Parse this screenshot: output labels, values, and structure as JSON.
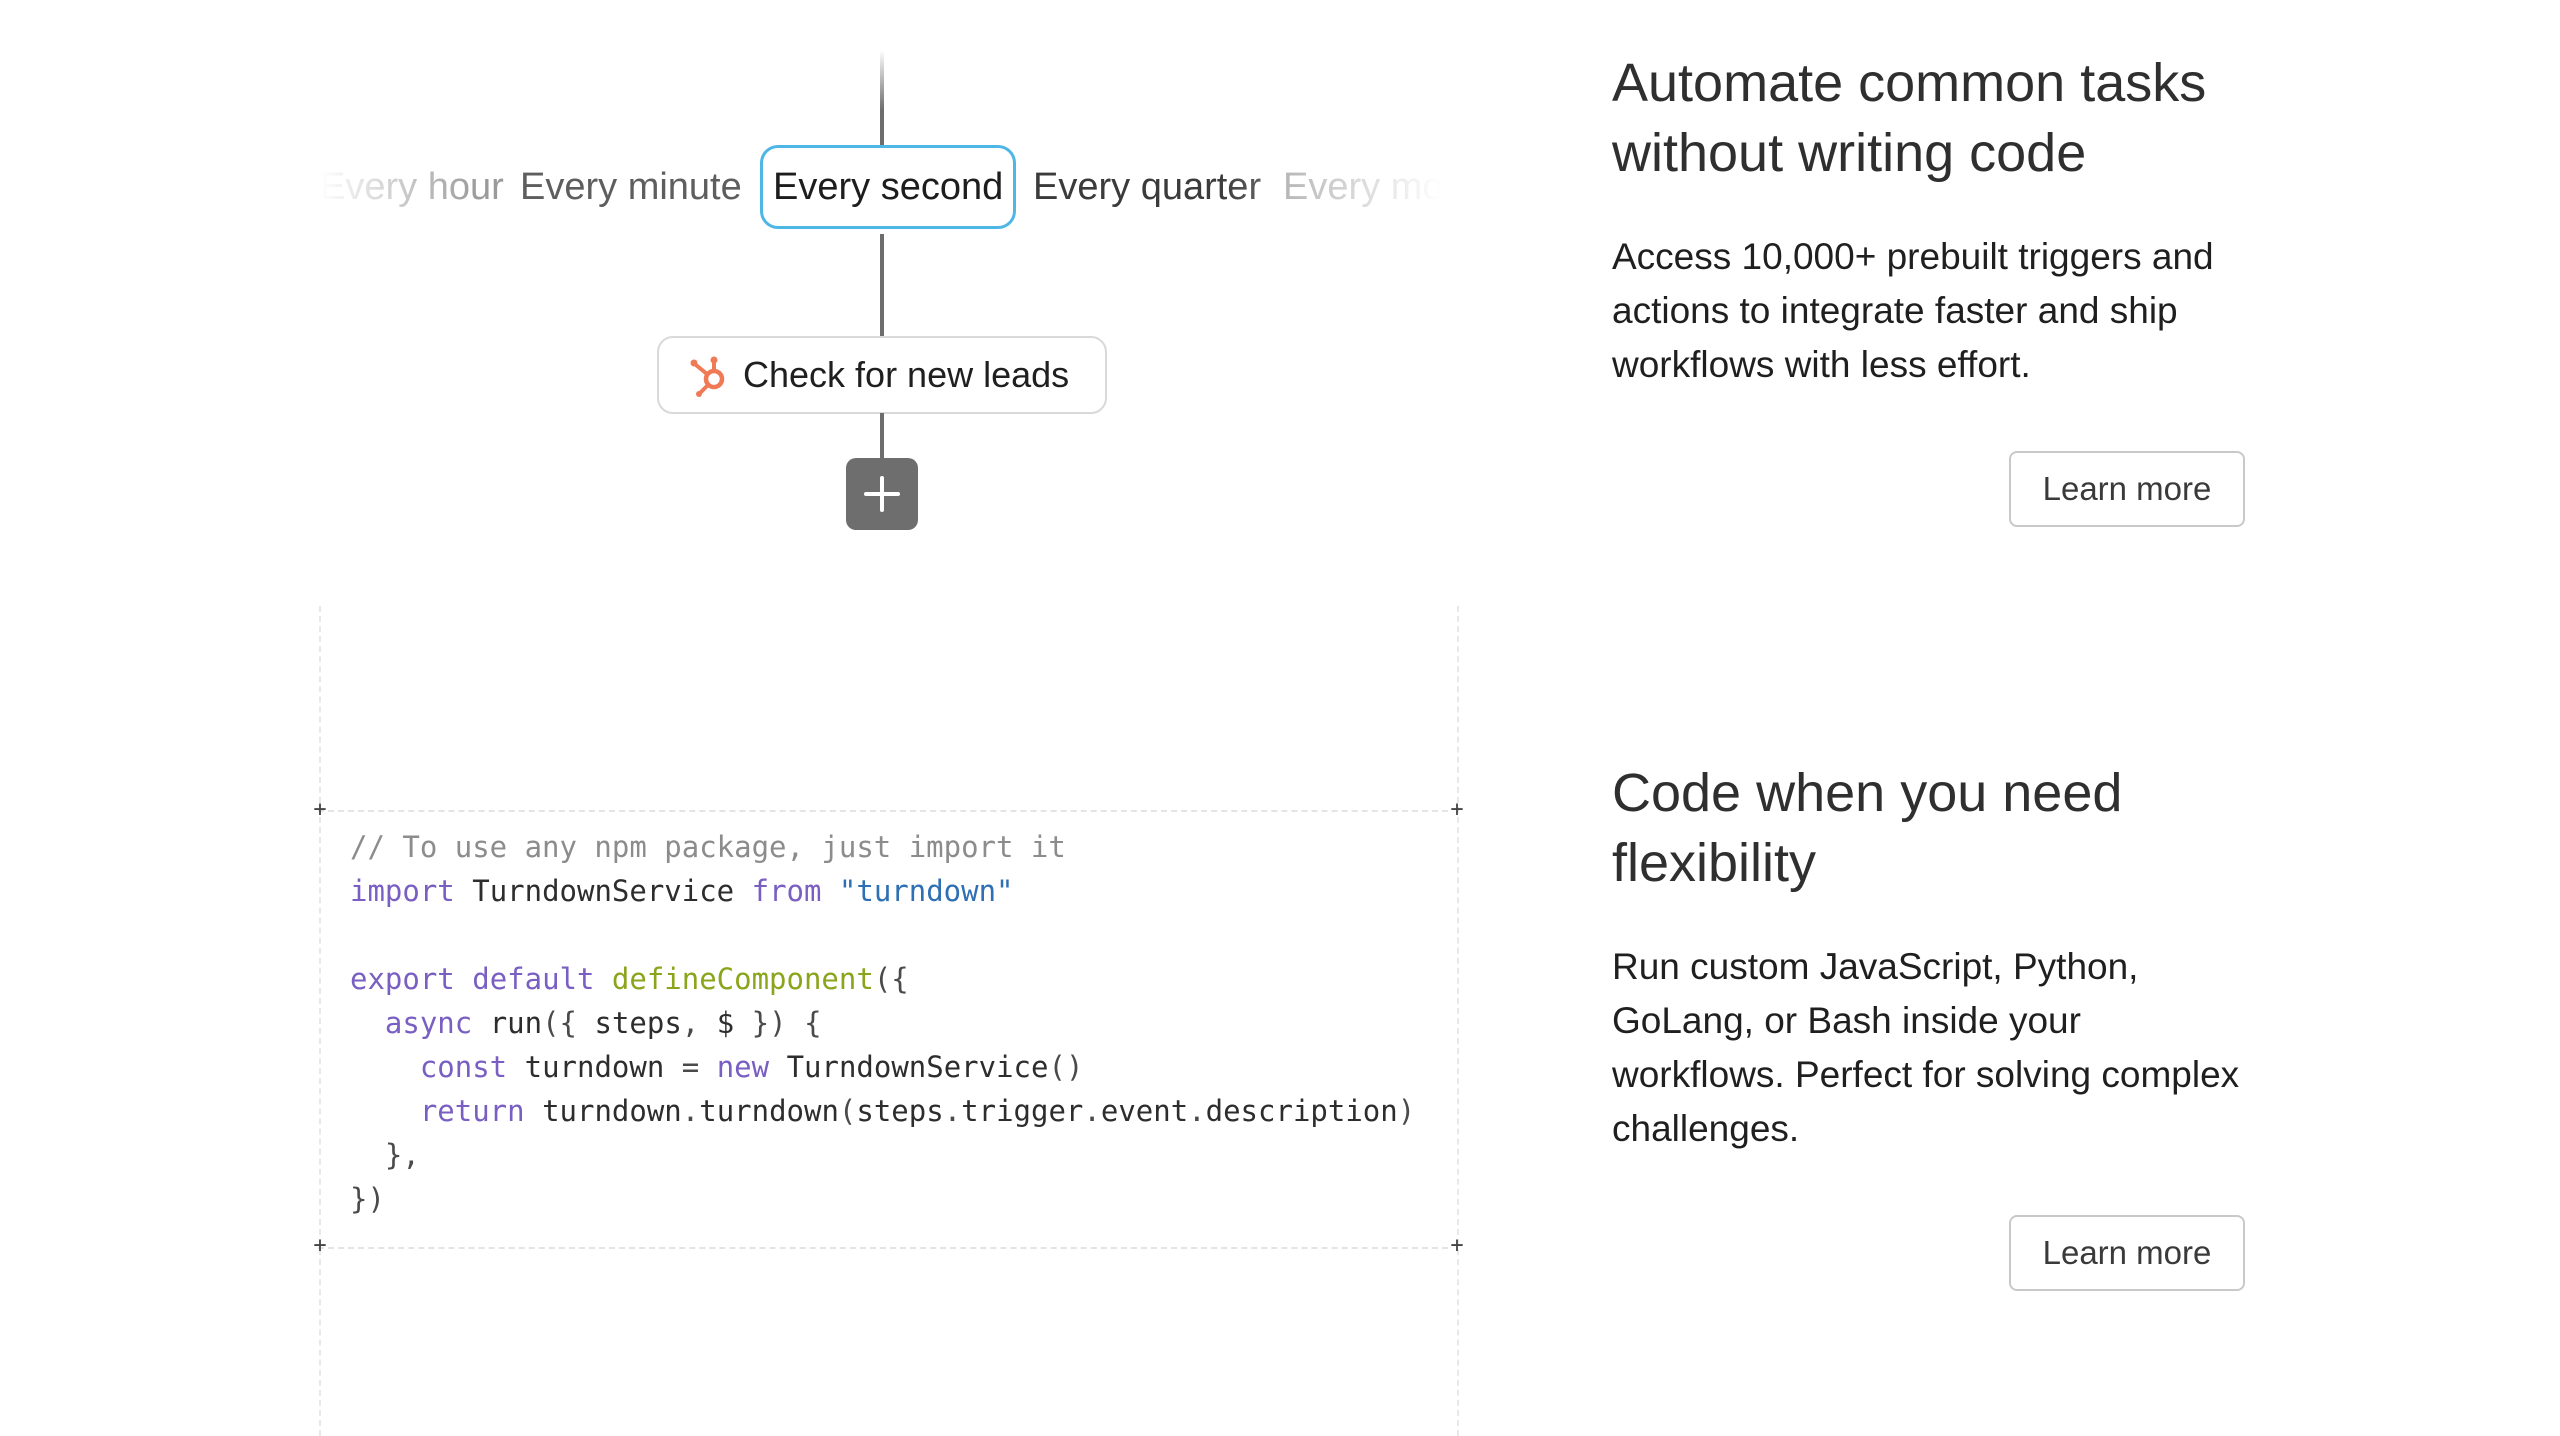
{
  "diagram": {
    "schedule_options": [
      {
        "label": "Every hour",
        "state": "faded"
      },
      {
        "label": "Every minute",
        "state": "normal"
      },
      {
        "label": "Every second",
        "state": "selected"
      },
      {
        "label": "Every quarter",
        "state": "normal"
      },
      {
        "label": "Every month",
        "state": "faded"
      }
    ],
    "trigger_step": {
      "label": "Check for new leads",
      "icon": "hubspot-icon"
    },
    "add_step_icon": "plus-icon"
  },
  "code_block": {
    "lines": [
      "// To use any npm package, just import it",
      "import TurndownService from \"turndown\"",
      "",
      "export default defineComponent({",
      "  async run({ steps, $ }) {",
      "    const turndown = new TurndownService()",
      "    return turndown.turndown(steps.trigger.event.description)",
      "  },",
      "})"
    ]
  },
  "features": [
    {
      "title_line1": "Automate common tasks",
      "title_line2": "without writing code",
      "description": "Access 10,000+ prebuilt triggers and actions to integrate faster and ship workflows with less effort.",
      "button_label": "Learn more"
    },
    {
      "title_line1": "Code when you need",
      "title_line2": "flexibility",
      "description": "Run custom JavaScript, Python, GoLang, or Bash inside your workflows. Perfect for solving complex challenges.",
      "button_label": "Learn more"
    }
  ],
  "colors": {
    "selected_border": "#4fb7e6",
    "hubspot_orange": "#ef7a55",
    "keyword_purple": "#7a5fc2",
    "string_blue": "#2f6fb3",
    "function_green": "#8aa51b"
  }
}
